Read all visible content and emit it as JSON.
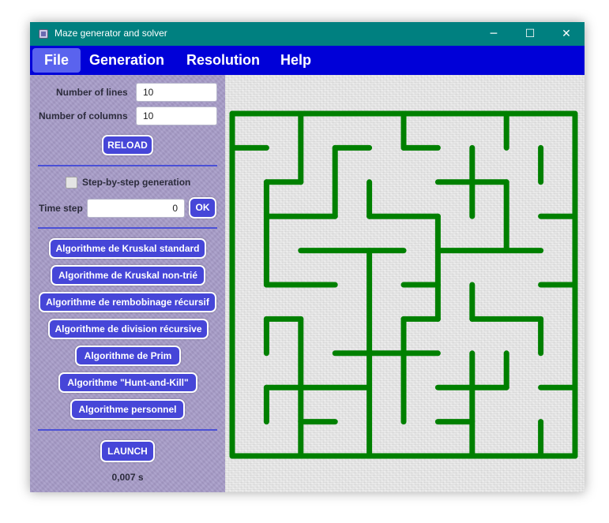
{
  "window": {
    "title": "Maze generator and solver"
  },
  "title_controls": {
    "minimize": "─",
    "maximize": "☐",
    "close": "✕"
  },
  "menu": {
    "file": "File",
    "generation": "Generation",
    "resolution": "Resolution",
    "help": "Help"
  },
  "settings": {
    "lines_label": "Number of lines",
    "lines_value": "10",
    "columns_label": "Number of columns",
    "columns_value": "10",
    "reload_label": "RELOAD",
    "step_by_step_label": "Step-by-step generation",
    "step_by_step_checked": false,
    "time_step_label": "Time step",
    "time_step_value": "0",
    "ok_label": "OK"
  },
  "algorithms": [
    "Algorithme de Kruskal standard",
    "Algorithme de Kruskal non-trié",
    "Algorithme de rembobinage récursif",
    "Algorithme de division récursive",
    "Algorithme de Prim",
    "Algorithme \"Hunt-and-Kill\"",
    "Algorithme personnel"
  ],
  "launch_label": "LAUNCH",
  "elapsed_time": "0,007 s",
  "maze": {
    "rows": 10,
    "columns": 10,
    "wall_color": "#008000",
    "walls": [
      [
        0,
        0,
        10,
        0
      ],
      [
        0,
        10,
        10,
        10
      ],
      [
        0,
        0,
        0,
        10
      ],
      [
        10,
        0,
        10,
        10
      ],
      [
        0,
        1,
        1,
        1
      ],
      [
        2,
        0,
        2,
        2
      ],
      [
        3,
        1,
        3,
        3
      ],
      [
        3,
        1,
        4,
        1
      ],
      [
        5,
        0,
        5,
        1
      ],
      [
        5,
        1,
        6,
        1
      ],
      [
        8,
        0,
        8,
        1
      ],
      [
        7,
        1,
        7,
        3
      ],
      [
        6,
        2,
        8,
        2
      ],
      [
        9,
        1,
        9,
        2
      ],
      [
        8,
        2,
        8,
        4
      ],
      [
        1,
        2,
        1,
        5
      ],
      [
        1,
        2,
        2,
        2
      ],
      [
        1,
        3,
        3,
        3
      ],
      [
        4,
        2,
        4,
        3
      ],
      [
        4,
        3,
        6,
        3
      ],
      [
        9,
        3,
        10,
        3
      ],
      [
        6,
        3,
        6,
        5
      ],
      [
        2,
        4,
        5,
        4
      ],
      [
        6,
        4,
        9,
        4
      ],
      [
        4,
        4,
        4,
        10
      ],
      [
        1,
        5,
        3,
        5
      ],
      [
        5,
        5,
        6,
        5
      ],
      [
        7,
        5,
        7,
        6
      ],
      [
        9,
        5,
        10,
        5
      ],
      [
        7,
        6,
        9,
        6
      ],
      [
        9,
        6,
        9,
        7
      ],
      [
        1,
        6,
        1,
        7
      ],
      [
        1,
        6,
        2,
        6
      ],
      [
        2,
        6,
        2,
        10
      ],
      [
        3,
        7,
        6,
        7
      ],
      [
        6,
        5,
        6,
        6
      ],
      [
        5,
        6,
        6,
        6
      ],
      [
        5,
        6,
        5,
        8
      ],
      [
        7,
        7,
        7,
        10
      ],
      [
        8,
        7,
        8,
        8
      ],
      [
        1,
        8,
        4,
        8
      ],
      [
        1,
        8,
        1,
        9
      ],
      [
        6,
        8,
        8,
        8
      ],
      [
        9,
        8,
        10,
        8
      ],
      [
        2,
        9,
        3,
        9
      ],
      [
        5,
        8,
        5,
        9
      ],
      [
        6,
        9,
        7,
        9
      ],
      [
        9,
        9,
        9,
        10
      ]
    ]
  }
}
